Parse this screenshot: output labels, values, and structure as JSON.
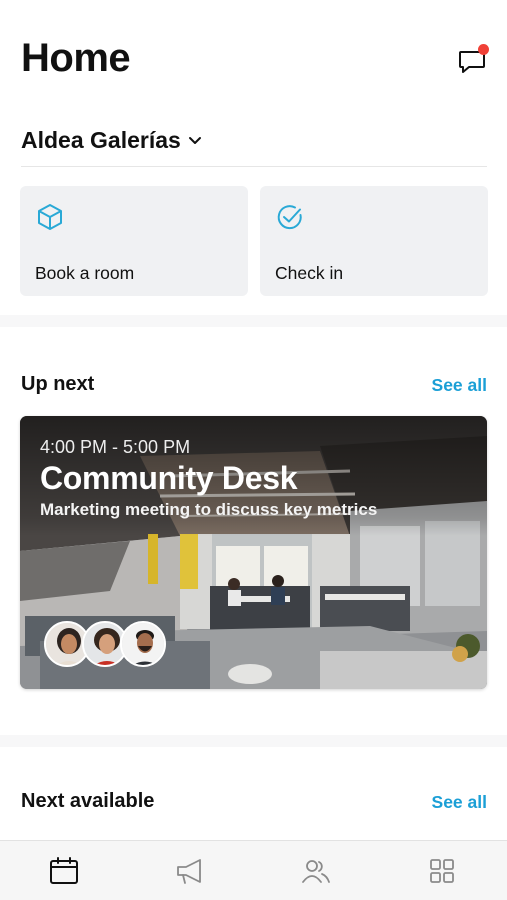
{
  "header": {
    "title": "Home",
    "chat_icon": "chat-bubble-icon",
    "notification_color": "#f04137"
  },
  "location": {
    "name": "Aldea Galerías",
    "chevron_icon": "chevron-down-icon"
  },
  "quick_actions": [
    {
      "label": "Book a room",
      "icon": "cube-icon"
    },
    {
      "label": "Check in",
      "icon": "check-circle-icon"
    }
  ],
  "up_next": {
    "title": "Up next",
    "see_all": "See all",
    "event": {
      "time": "4:00 PM - 5:00 PM",
      "title": "Community Desk",
      "subtitle": "Marketing meeting to discuss key metrics",
      "attendees": [
        "attendee-1",
        "attendee-2",
        "attendee-3"
      ]
    }
  },
  "next_available": {
    "title": "Next available",
    "see_all": "See all"
  },
  "bottom_nav": [
    {
      "name": "calendar",
      "icon": "calendar-icon"
    },
    {
      "name": "announcements",
      "icon": "megaphone-icon"
    },
    {
      "name": "people",
      "icon": "people-icon"
    },
    {
      "name": "apps",
      "icon": "grid-icon"
    }
  ],
  "colors": {
    "accent": "#1b9fd6",
    "icon_accent": "#29a9d6",
    "card_bg": "#f0f1f3"
  }
}
